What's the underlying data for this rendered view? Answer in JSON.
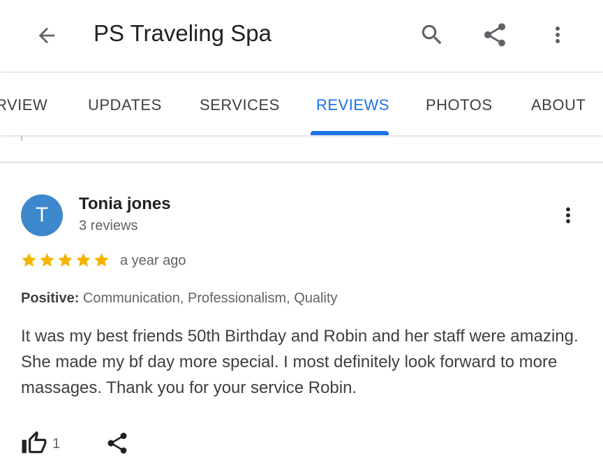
{
  "appbar": {
    "title": "PS Traveling Spa",
    "icons": [
      "arrow-back-icon",
      "search-icon",
      "share-icon",
      "more-vert-icon"
    ]
  },
  "tabs": [
    {
      "label": "RVIEW",
      "selected": false
    },
    {
      "label": "UPDATES",
      "selected": false
    },
    {
      "label": "SERVICES",
      "selected": false
    },
    {
      "label": "REVIEWS",
      "selected": true
    },
    {
      "label": "PHOTOS",
      "selected": false
    },
    {
      "label": "ABOUT",
      "selected": false
    }
  ],
  "colors": {
    "accent": "#1a73e8",
    "star": "#f4b400",
    "avatar": "#3d87cc",
    "text_primary": "#202124",
    "text_secondary": "#5f6368"
  },
  "review": {
    "avatar_initial": "T",
    "reviewer_name": "Tonia jones",
    "reviewer_reviews": "3 reviews",
    "rating": 5,
    "rating_max": 5,
    "time": "a year ago",
    "attributes_label": "Positive:",
    "attributes_value": "Communication, Professionalism, Quality",
    "text": "It was my best friends 50th Birthday and Robin and her staff were amazing. She made my bf day more special. I most definitely look forward to more massages. Thank you for your service Robin.",
    "likes": "1",
    "icons": [
      "thumb-up-icon",
      "share-icon",
      "more-vert-icon"
    ]
  }
}
